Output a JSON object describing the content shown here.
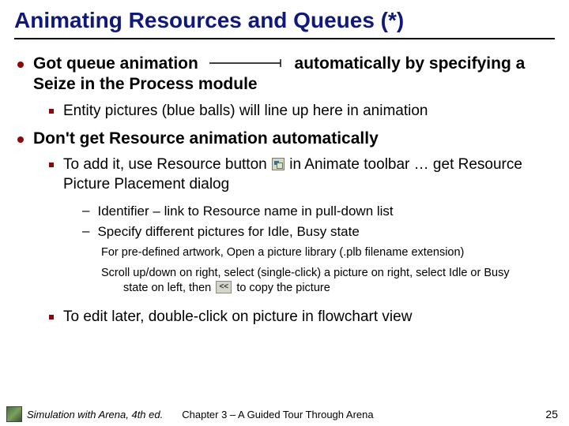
{
  "title": "Animating Resources and Queues (*)",
  "b1": {
    "pre": "Got queue animation",
    "post": "automatically by specifying a Seize in the Process module",
    "sub1": "Entity pictures (blue balls) will line up here in animation"
  },
  "b2": {
    "text": "Don't get Resource animation automatically",
    "sub1_pre": "To add it, use Resource button",
    "sub1_post": "in Animate toolbar … get Resource Picture Placement dialog",
    "sub1a": "Identifier – link to Resource name in pull-down list",
    "sub1b": "Specify different pictures for Idle, Busy state",
    "note1": "For pre-defined artwork, Open a picture library (.plb filename extension)",
    "note2a": "Scroll up/down on right, select (single-click) a picture on right, select Idle or Busy",
    "note2b": "state on left, then",
    "note2c": "to copy the picture",
    "sub2": "To edit later, double-click on picture in flowchart view"
  },
  "footer": {
    "book": "Simulation with Arena, 4th ed.",
    "chapter": "Chapter 3 – A Guided Tour Through Arena",
    "page": "25"
  },
  "icons": {
    "copy_glyph": "<<"
  }
}
